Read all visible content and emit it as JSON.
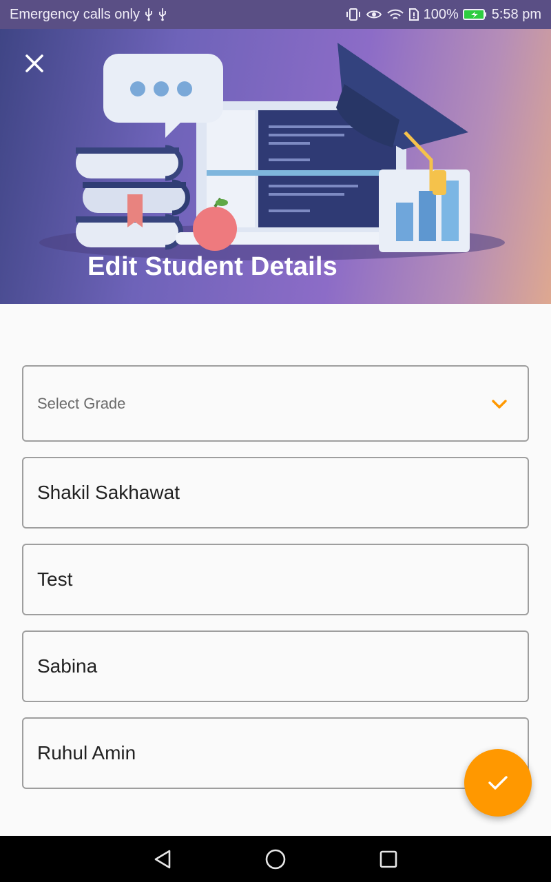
{
  "status_bar": {
    "carrier": "Emergency calls only",
    "battery": "100%",
    "time": "5:58 pm",
    "battery_color": "#2ecc40"
  },
  "header": {
    "title": "Edit Student Details",
    "close_icon": "close-icon"
  },
  "form": {
    "grade_select": {
      "placeholder": "Select Grade",
      "icon": "chevron-down-icon",
      "accent": "#ff9800"
    },
    "fields": [
      {
        "value": "Shakil Sakhawat"
      },
      {
        "value": "Test"
      },
      {
        "value": "Sabina"
      },
      {
        "value": "Ruhul Amin"
      }
    ]
  },
  "fab": {
    "icon": "check-icon",
    "color": "#ff9800"
  },
  "nav_bar": {
    "icons": [
      "back-icon",
      "home-icon",
      "recents-icon"
    ]
  }
}
